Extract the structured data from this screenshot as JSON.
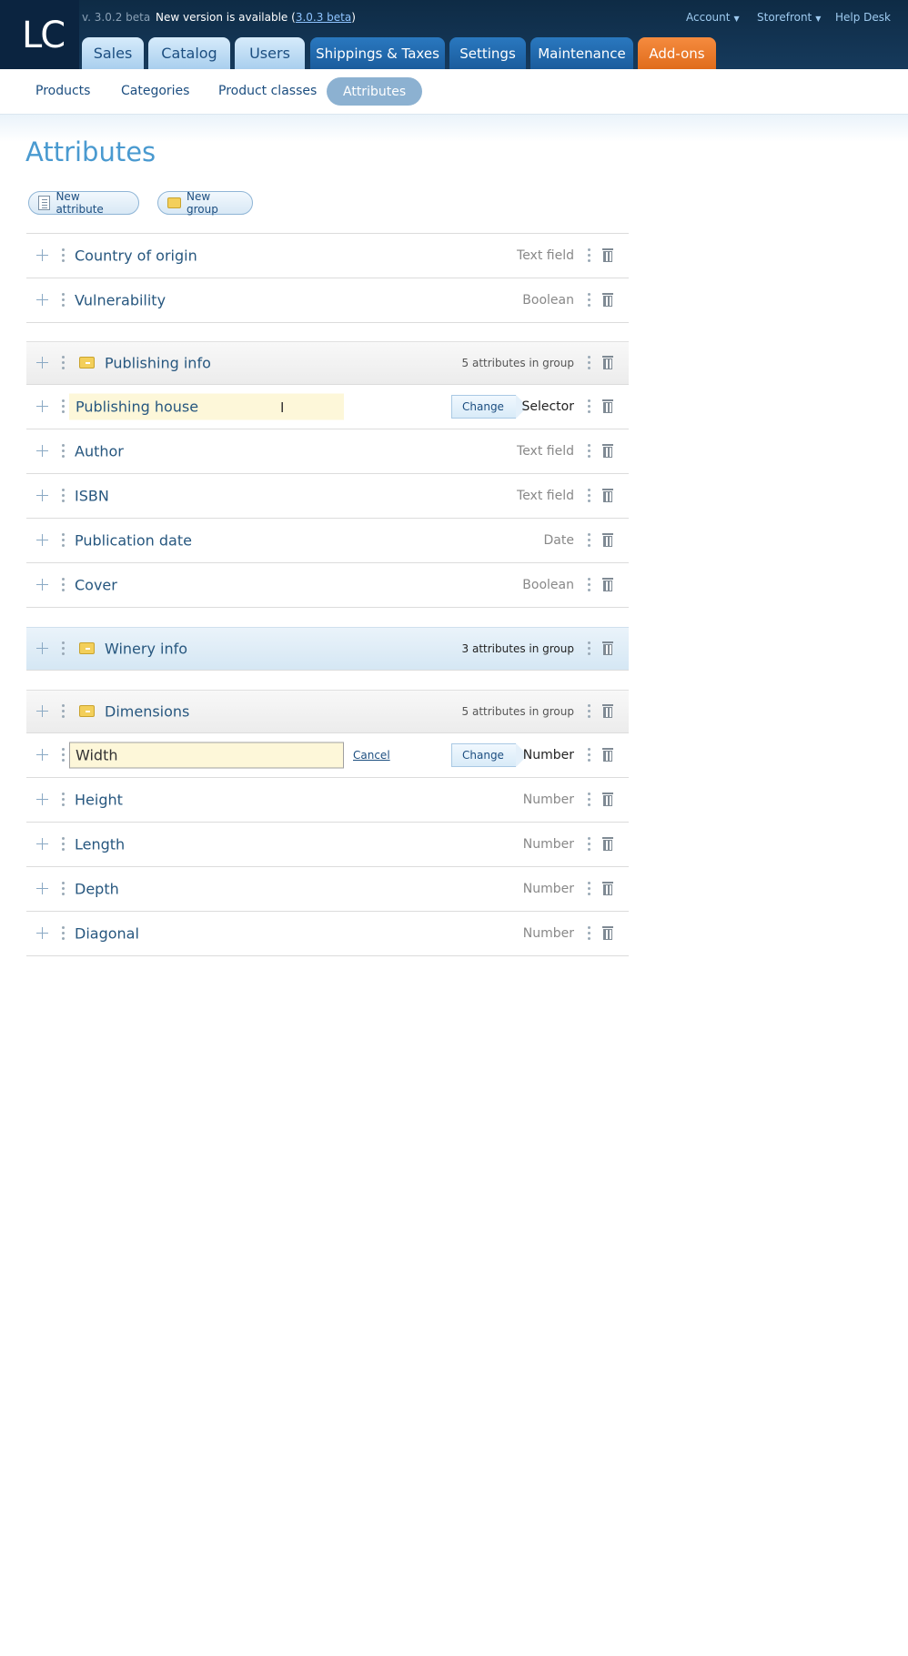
{
  "header": {
    "logo": "LC",
    "version": "v. 3.0.2 beta",
    "new_version_prefix": "New version is available (",
    "new_version_link": "3.0.3 beta",
    "new_version_suffix": ")",
    "account": "Account",
    "storefront": "Storefront",
    "help_desk": "Help Desk"
  },
  "tabs": [
    "Sales",
    "Catalog",
    "Users",
    "Shippings & Taxes",
    "Settings",
    "Maintenance",
    "Add-ons"
  ],
  "subnav": [
    "Products",
    "Categories",
    "Product classes",
    "Attributes"
  ],
  "page": {
    "title": "Attributes",
    "new_attribute": "New attribute",
    "new_group": "New group",
    "change_label": "Change",
    "cancel_label": "Cancel"
  },
  "ungrouped": [
    {
      "name": "Country of origin",
      "type": "Text field"
    },
    {
      "name": "Vulnerability",
      "type": "Boolean"
    }
  ],
  "groups": [
    {
      "name": "Publishing info",
      "count": "5 attributes in group",
      "attributes": [
        {
          "name": "Publishing house",
          "type": "Selector"
        },
        {
          "name": "Author",
          "type": "Text field"
        },
        {
          "name": "ISBN",
          "type": "Text field"
        },
        {
          "name": "Publication date",
          "type": "Date"
        },
        {
          "name": "Cover",
          "type": "Boolean"
        }
      ]
    },
    {
      "name": "Winery info",
      "count": "3 attributes in group",
      "attributes": []
    },
    {
      "name": "Dimensions",
      "count": "5 attributes in group",
      "attributes": [
        {
          "name": "Width",
          "type": "Number"
        },
        {
          "name": "Height",
          "type": "Number"
        },
        {
          "name": "Length",
          "type": "Number"
        },
        {
          "name": "Depth",
          "type": "Number"
        },
        {
          "name": "Diagonal",
          "type": "Number"
        }
      ]
    }
  ]
}
